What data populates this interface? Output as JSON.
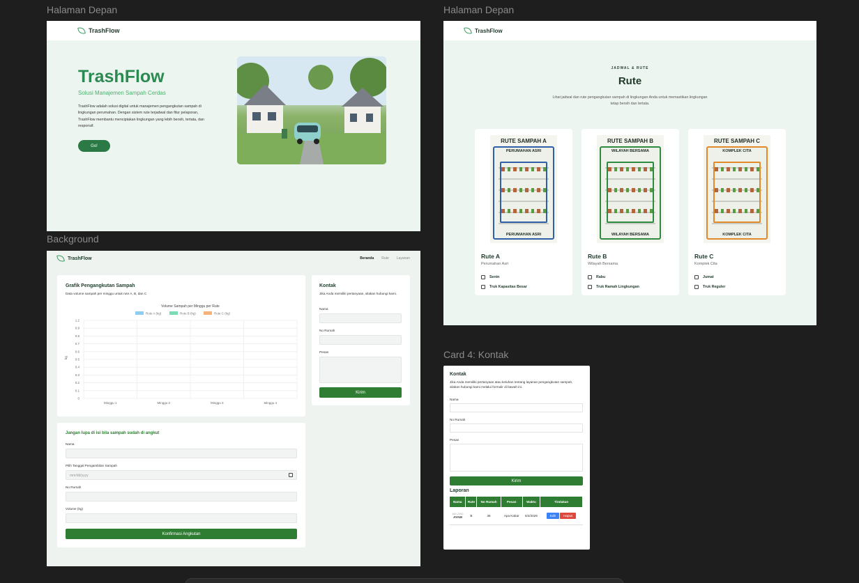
{
  "frames": {
    "f1_label": "Halaman Depan",
    "f2_label": "Halaman Depan",
    "f3_label": "Background",
    "f4_label": "Card 4: Kontak"
  },
  "brand": "TrashFlow",
  "hero": {
    "title": "TrashFlow",
    "subtitle": "Solusi Manajemen Sampah Cerdas",
    "description": "TrashFlow adalah solusi digital untuk manajemen pengangkutan sampah di lingkungan perumahan. Dengan sistem rute terjadwal dan fitur pelaporan, TrashFlow membantu menciptakan lingkungan yang lebih bersih, tertata, dan responsif.",
    "cta": "Go!"
  },
  "routes_section": {
    "eyebrow": "JADWAL & RUTE",
    "title": "Rute",
    "description": "Lihat jadwal dan rute pengangkutan sampah di lingkungan Anda untuk memastikan lingkungan tetap bersih dan tertata.",
    "cards": [
      {
        "map_title": "RUTE SAMPAH A",
        "map_sub": "PERUMAHAN ASRI",
        "map_foot": "PERUMAHAN ASRI",
        "name": "Rute A",
        "area": "Perumahan Asri",
        "day": "Senin",
        "truck": "Truk Kapasitas Besar",
        "color": "#2f5fa8"
      },
      {
        "map_title": "RUTE SAMPAH B",
        "map_sub": "WILAYAH BERSAMA",
        "map_foot": "WILAYAH BERSAMA",
        "name": "Rute B",
        "area": "Wilayah Bersama",
        "day": "Rabu",
        "truck": "Truk Ramah Lingkungan",
        "color": "#2e8b3e"
      },
      {
        "map_title": "RUTE SAMPAH C",
        "map_sub": "KOMPLEK CITA",
        "map_foot": "KOMPLEK CITA",
        "name": "Rute C",
        "area": "Komplek Cita",
        "day": "Jumat",
        "truck": "Truk Reguler",
        "color": "#e08a2a"
      }
    ]
  },
  "bg_page": {
    "nav_links": [
      "Beranda",
      "Rute",
      "Layanan"
    ],
    "chart_card": {
      "title": "Grafik Pengangkutan Sampah",
      "subtitle": "Data volume sampah per minggu untuk rute A, B, dan C"
    },
    "contact": {
      "title": "Kontak",
      "subtitle": "Jika Anda memiliki pertanyaan, silakan hubungi kami.",
      "name_label": "Nama",
      "house_label": "No Rumah",
      "message_label": "Pesan",
      "submit": "Kirim"
    },
    "pickup_form": {
      "title": "Jangan lupa di isi bila sampah sudah di angkut",
      "name_label": "Nama",
      "date_label": "Pilih Tanggal Pengambilan Sampah",
      "date_placeholder": "mm/dd/yyyy",
      "house_label": "No Rumah",
      "volume_label": "Volume (kg)",
      "submit": "Konfirmasi Angkutan"
    }
  },
  "chart_data": {
    "type": "line",
    "title": "Volume Sampah per Minggu per Rute",
    "categories": [
      "Minggu 1",
      "Minggu 2",
      "Minggu 3",
      "Minggu 4"
    ],
    "series": [
      {
        "name": "Rute A (kg)",
        "values": [],
        "color": "#8ecdf0"
      },
      {
        "name": "Rute B (kg)",
        "values": [],
        "color": "#7ddbb3"
      },
      {
        "name": "Rute C (kg)",
        "values": [],
        "color": "#f5b27a"
      }
    ],
    "ylabel": "kg",
    "ylim": [
      0,
      1.2
    ],
    "yticks": [
      "1.2",
      "0.9",
      "0.8",
      "0.7",
      "0.6",
      "0.5",
      "0.4",
      "0.3",
      "0.2",
      "0.1",
      "0"
    ],
    "grid": true,
    "legend": "top"
  },
  "contact_card": {
    "title": "Kontak",
    "subtitle": "Jika Anda memiliki pertanyaan atau keluhan tentang layanan pengangkutan sampah, silakan hubungi kami melalui formulir di bawah ini.",
    "name_label": "Nama",
    "house_label": "No Rumah",
    "message_label": "Pesan",
    "submit": "Kirim",
    "report_title": "Laporan",
    "table": {
      "headers": [
        "Nama",
        "Rute",
        "No Rumah",
        "Pesan",
        "Waktu",
        "Tindakan"
      ],
      "rows": [
        {
          "name_small": "460-2050",
          "name": "AYAM",
          "route": "B",
          "house": "36",
          "message": "Apa Kabar",
          "time": "6/4/2026",
          "edit": "Edit",
          "delete": "Hapus"
        }
      ]
    }
  }
}
